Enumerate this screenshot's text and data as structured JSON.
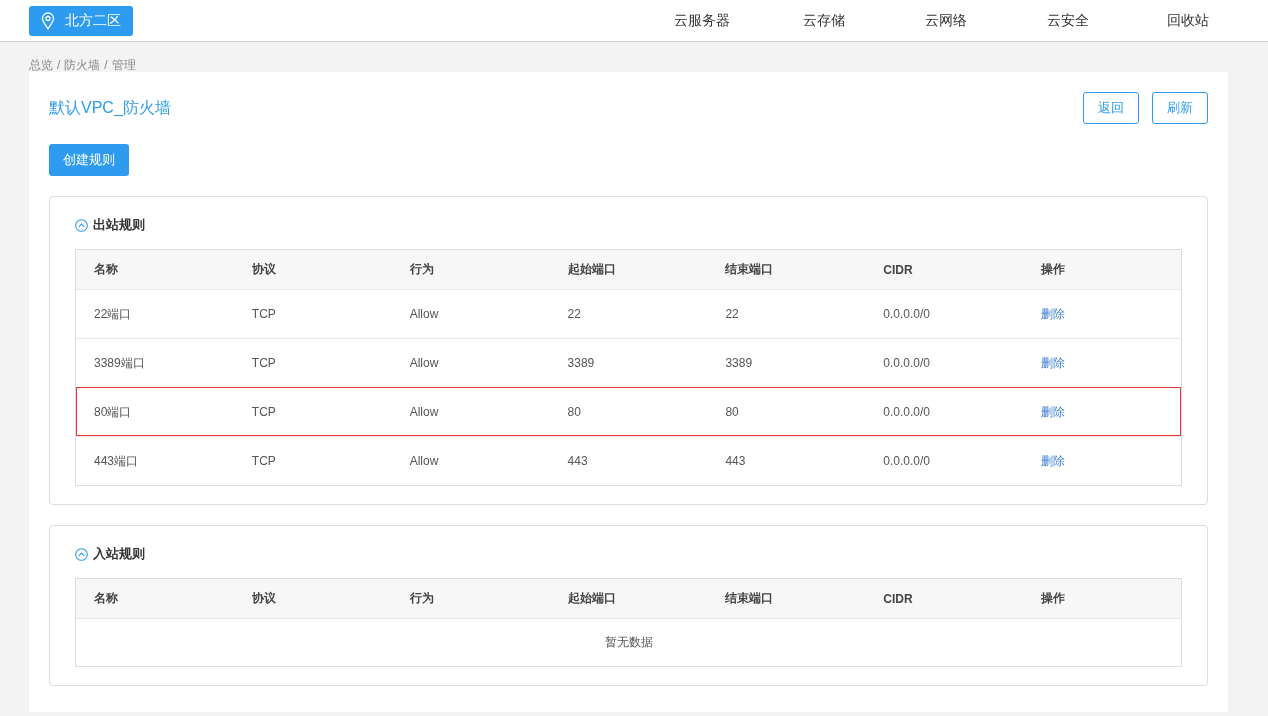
{
  "header": {
    "region": "北方二区",
    "nav": [
      {
        "label": "云服务器"
      },
      {
        "label": "云存储"
      },
      {
        "label": "云网络"
      },
      {
        "label": "云安全"
      },
      {
        "label": "回收站"
      }
    ]
  },
  "breadcrumb": {
    "items": [
      "总览",
      "防火墙",
      "管理"
    ],
    "separator": "/"
  },
  "page": {
    "title": "默认VPC_防火墙",
    "actions": [
      "返回",
      "刷新"
    ],
    "create_button": "创建规则"
  },
  "sections": [
    {
      "title": "出站规则",
      "expanded": true,
      "columns": [
        "名称",
        "协议",
        "行为",
        "起始端口",
        "结束端口",
        "CIDR",
        "操作"
      ],
      "rows": [
        {
          "cells": [
            "22端口",
            "TCP",
            "Allow",
            "22",
            "22",
            "0.0.0.0/0"
          ],
          "action": "删除",
          "highlighted": false
        },
        {
          "cells": [
            "3389端口",
            "TCP",
            "Allow",
            "3389",
            "3389",
            "0.0.0.0/0"
          ],
          "action": "删除",
          "highlighted": false
        },
        {
          "cells": [
            "80端口",
            "TCP",
            "Allow",
            "80",
            "80",
            "0.0.0.0/0"
          ],
          "action": "删除",
          "highlighted": true
        },
        {
          "cells": [
            "443端口",
            "TCP",
            "Allow",
            "443",
            "443",
            "0.0.0.0/0"
          ],
          "action": "删除",
          "highlighted": false
        }
      ]
    },
    {
      "title": "入站规则",
      "expanded": true,
      "columns": [
        "名称",
        "协议",
        "行为",
        "起始端口",
        "结束端口",
        "CIDR",
        "操作"
      ],
      "empty_text": "暂无数据"
    }
  ]
}
